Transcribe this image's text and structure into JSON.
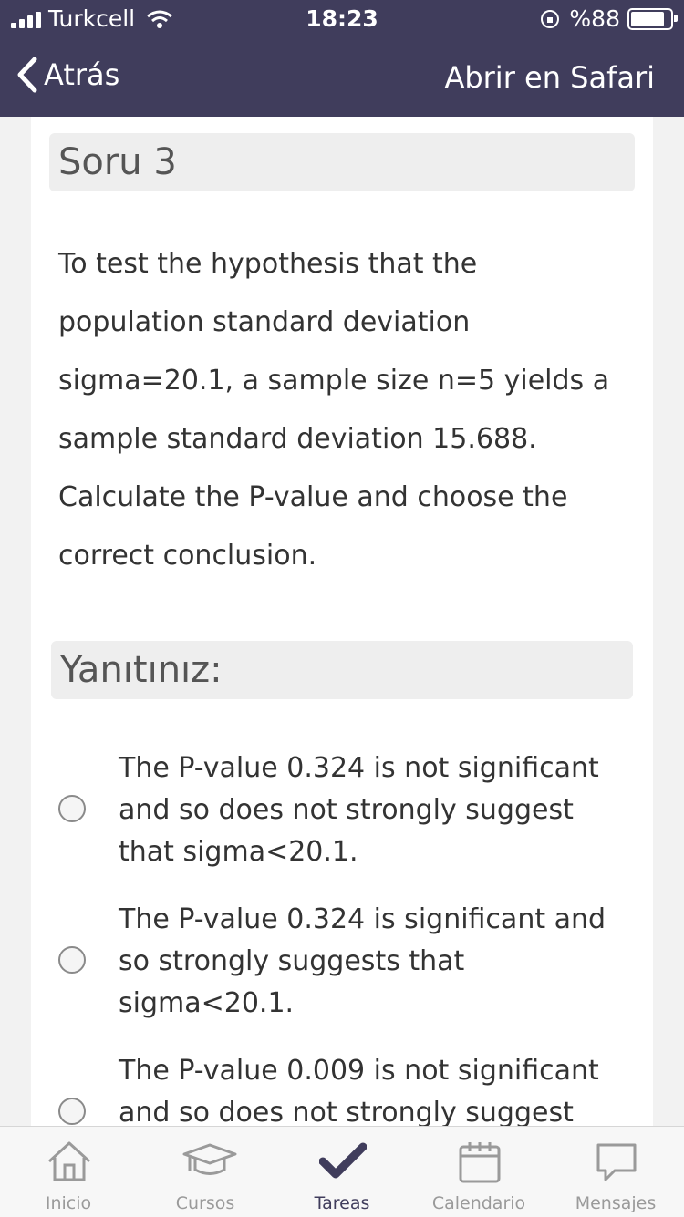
{
  "status_bar": {
    "carrier": "Turkcell",
    "time": "18:23",
    "battery": "%88"
  },
  "nav": {
    "back_label": "Atrás",
    "open_safari_label": "Abrir en Safari"
  },
  "question": {
    "title": "Soru 3",
    "lines": [
      "To test the hypothesis that the",
      "population standard deviation",
      "sigma=20.1, a sample size n=5 yields a",
      "sample standard deviation 15.688.",
      "Calculate the P-value and choose the",
      "correct conclusion."
    ]
  },
  "answer": {
    "header": "Yanıtınız:",
    "options": [
      {
        "lines": [
          "The P-value 0.324 is not significant",
          "and so does not strongly suggest",
          "that sigma<20.1."
        ]
      },
      {
        "lines": [
          "The P-value 0.324 is significant and",
          "so strongly suggests that",
          "sigma<20.1."
        ]
      },
      {
        "lines": [
          "The P-value 0.009 is not significant",
          "and so does not strongly suggest"
        ]
      }
    ]
  },
  "tab_bar": {
    "tabs": [
      {
        "label": "Inicio",
        "icon": "home-icon"
      },
      {
        "label": "Cursos",
        "icon": "graduation-cap-icon"
      },
      {
        "label": "Tareas",
        "icon": "checkmark-icon",
        "active": true
      },
      {
        "label": "Calendario",
        "icon": "calendar-icon"
      },
      {
        "label": "Mensajes",
        "icon": "chat-bubble-icon"
      }
    ]
  },
  "colors": {
    "header_bg": "#403d5c",
    "tab_inactive": "#9a9a9a",
    "tab_active": "#403d5c"
  }
}
